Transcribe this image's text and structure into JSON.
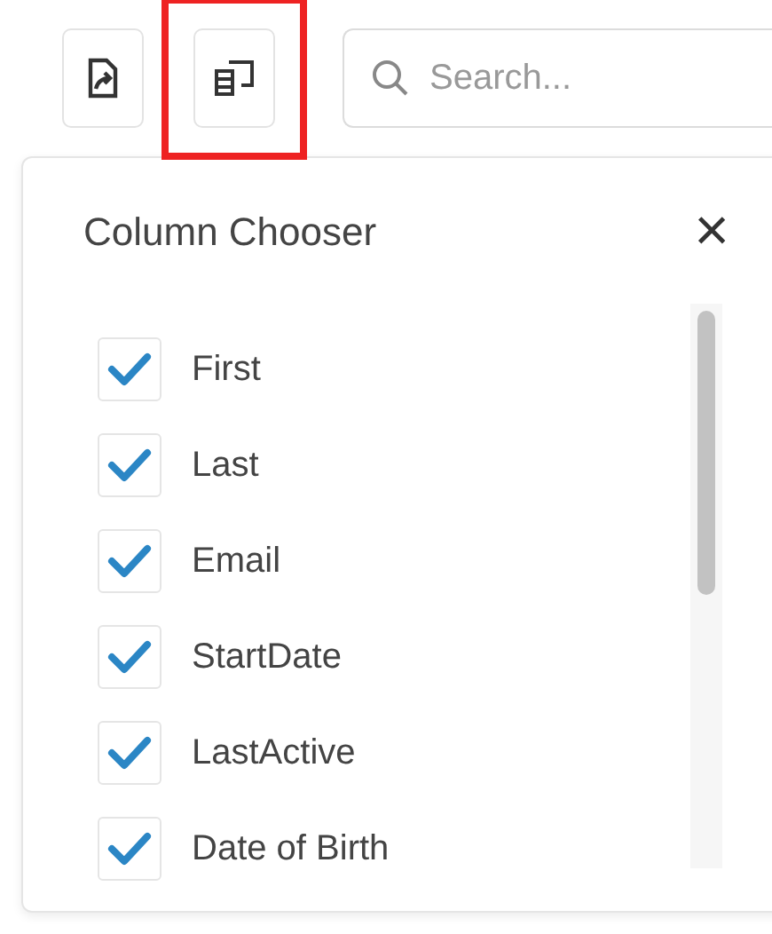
{
  "toolbar": {
    "buttons": [
      {
        "kind": "export",
        "highlighted": false
      },
      {
        "kind": "column-chooser",
        "highlighted": true
      }
    ],
    "search": {
      "placeholder": "Search..."
    }
  },
  "column_chooser": {
    "title": "Column Chooser",
    "close": "×",
    "columns": [
      {
        "label": "First",
        "checked": true
      },
      {
        "label": "Last",
        "checked": true
      },
      {
        "label": "Email",
        "checked": true
      },
      {
        "label": "StartDate",
        "checked": true
      },
      {
        "label": "LastActive",
        "checked": true
      },
      {
        "label": "Date of Birth",
        "checked": true
      }
    ]
  }
}
